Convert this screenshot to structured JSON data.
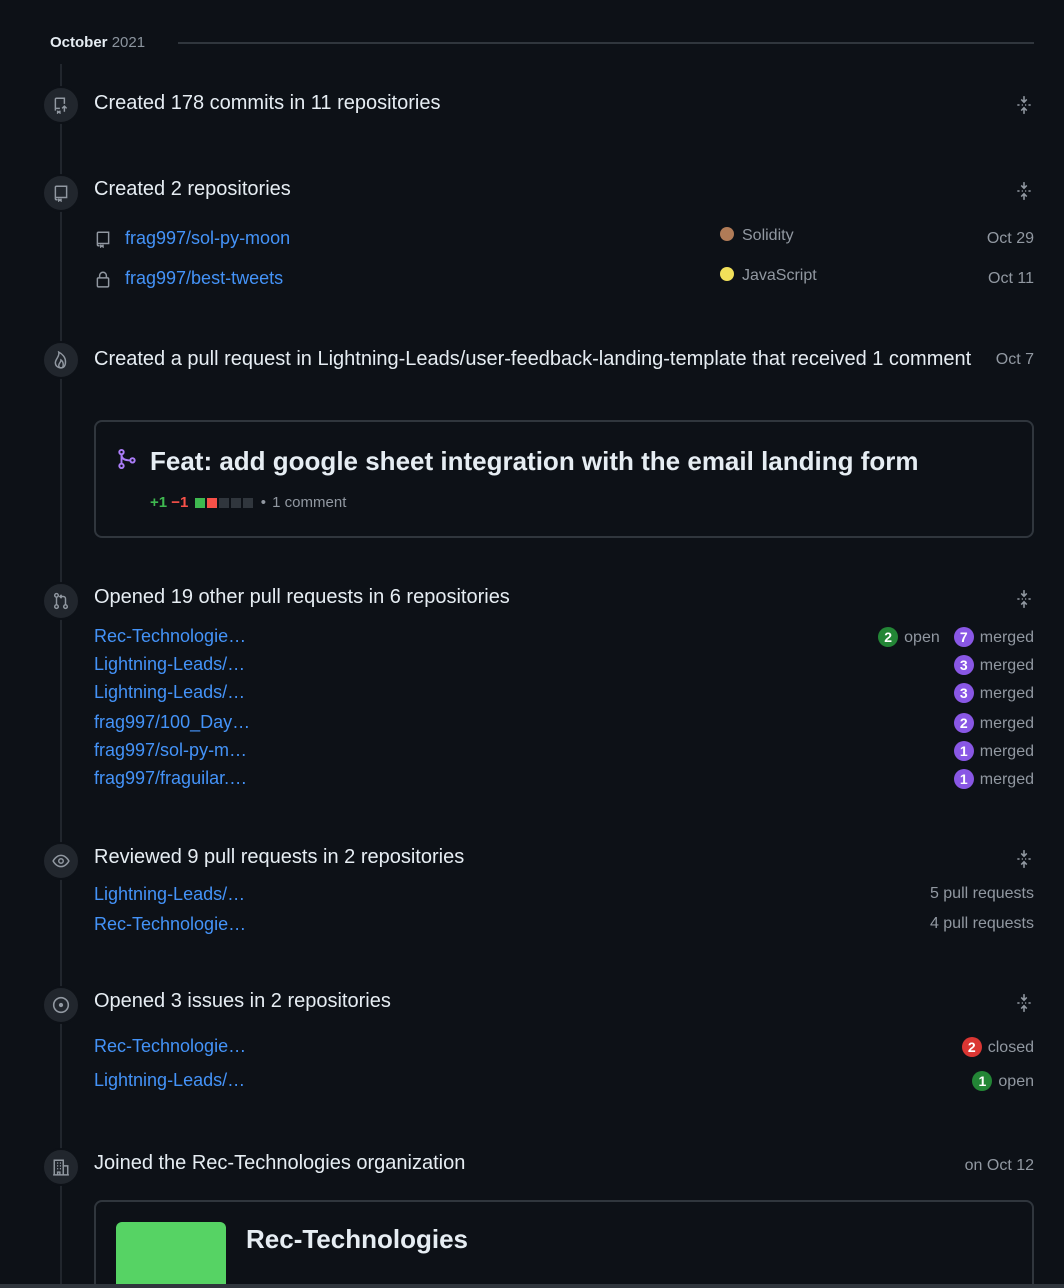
{
  "month": {
    "name": "October",
    "year": "2021"
  },
  "commits": {
    "title": "Created 178 commits in 11 repositories"
  },
  "repos": {
    "title": "Created 2 repositories",
    "items": [
      {
        "name": "frag997/sol-py-moon",
        "language": "Solidity",
        "lang_color": "#b07b57",
        "date": "Oct 29",
        "icon": "repo-icon"
      },
      {
        "name": "frag997/best-tweets",
        "language": "JavaScript",
        "lang_color": "#f1e05a",
        "date": "Oct 11",
        "icon": "lock-icon"
      }
    ]
  },
  "pull_request": {
    "title": "Created a pull request in Lightning-Leads/user-feedback-landing-template that received 1 comment",
    "date": "Oct 7",
    "heading": "Feat: add google sheet integration with the email landing form",
    "additions": "+1",
    "deletions": "−1",
    "comments": "1 comment"
  },
  "opened_prs": {
    "title": "Opened 19 other pull requests in 6 repositories",
    "items": [
      {
        "name": "Rec-Technologie…",
        "open": "2",
        "open_label": "open",
        "merged": "7",
        "merged_label": "merged"
      },
      {
        "name": "Lightning-Leads/…",
        "merged": "3",
        "merged_label": "merged"
      },
      {
        "name": "Lightning-Leads/…",
        "merged": "3",
        "merged_label": "merged"
      },
      {
        "name": "frag997/100_Day…",
        "merged": "2",
        "merged_label": "merged"
      },
      {
        "name": "frag997/sol-py-m…",
        "merged": "1",
        "merged_label": "merged"
      },
      {
        "name": "frag997/fraguilar.…",
        "merged": "1",
        "merged_label": "merged"
      }
    ]
  },
  "reviews": {
    "title": "Reviewed 9 pull requests in 2 repositories",
    "items": [
      {
        "name": "Lightning-Leads/…",
        "count": "5 pull requests"
      },
      {
        "name": "Rec-Technologie…",
        "count": "4 pull requests"
      }
    ]
  },
  "issues": {
    "title": "Opened 3 issues in 2 repositories",
    "items": [
      {
        "name": "Rec-Technologie…",
        "count": "2",
        "label": "closed"
      },
      {
        "name": "Lightning-Leads/…",
        "count": "1",
        "label": "open"
      }
    ]
  },
  "org": {
    "title": "Joined the Rec-Technologies organization",
    "date": "on Oct 12",
    "name": "Rec-Technologies",
    "logo_color": "#56d364"
  }
}
